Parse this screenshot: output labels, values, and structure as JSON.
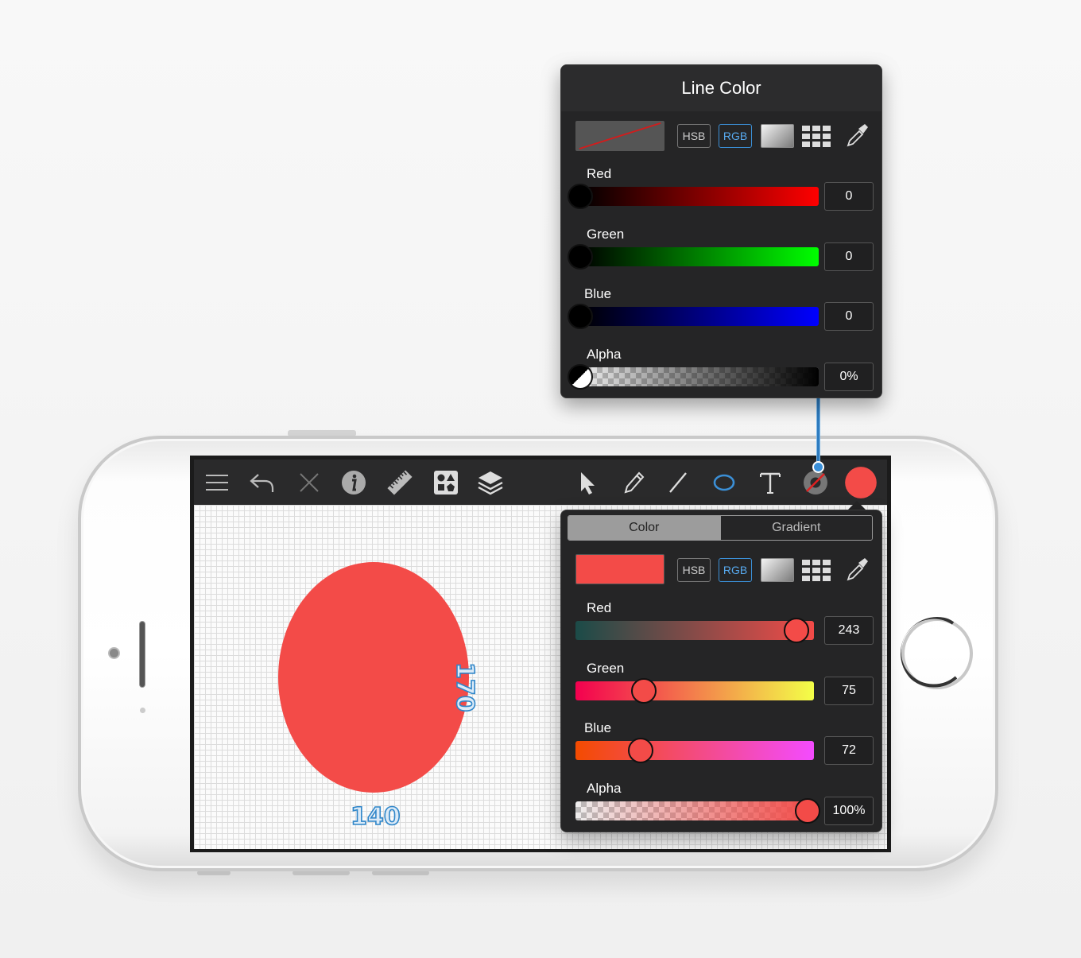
{
  "line_color_panel": {
    "title": "Line Color",
    "modes": {
      "hsb": "HSB",
      "rgb": "RGB"
    },
    "sliders": [
      {
        "label": "Red",
        "value": "0",
        "fraction": 0
      },
      {
        "label": "Green",
        "value": "0",
        "fraction": 0
      },
      {
        "label": "Blue",
        "value": "0",
        "fraction": 0
      },
      {
        "label": "Alpha",
        "value": "0%",
        "fraction": 0
      }
    ]
  },
  "fill_color_panel": {
    "tabs": {
      "color": "Color",
      "gradient": "Gradient"
    },
    "active_tab": "Color",
    "modes": {
      "hsb": "HSB",
      "rgb": "RGB"
    },
    "swatch_color": "#f34b48",
    "sliders": [
      {
        "label": "Red",
        "value": "243",
        "fraction": 0.953
      },
      {
        "label": "Green",
        "value": "75",
        "fraction": 0.294
      },
      {
        "label": "Blue",
        "value": "72",
        "fraction": 0.282
      },
      {
        "label": "Alpha",
        "value": "100%",
        "fraction": 1.0
      }
    ]
  },
  "canvas": {
    "shape_color": "#f34b48",
    "width_label": "140",
    "height_label": "170"
  },
  "colors": {
    "accent": "#3b8fd6",
    "fill": "#f34b48"
  }
}
